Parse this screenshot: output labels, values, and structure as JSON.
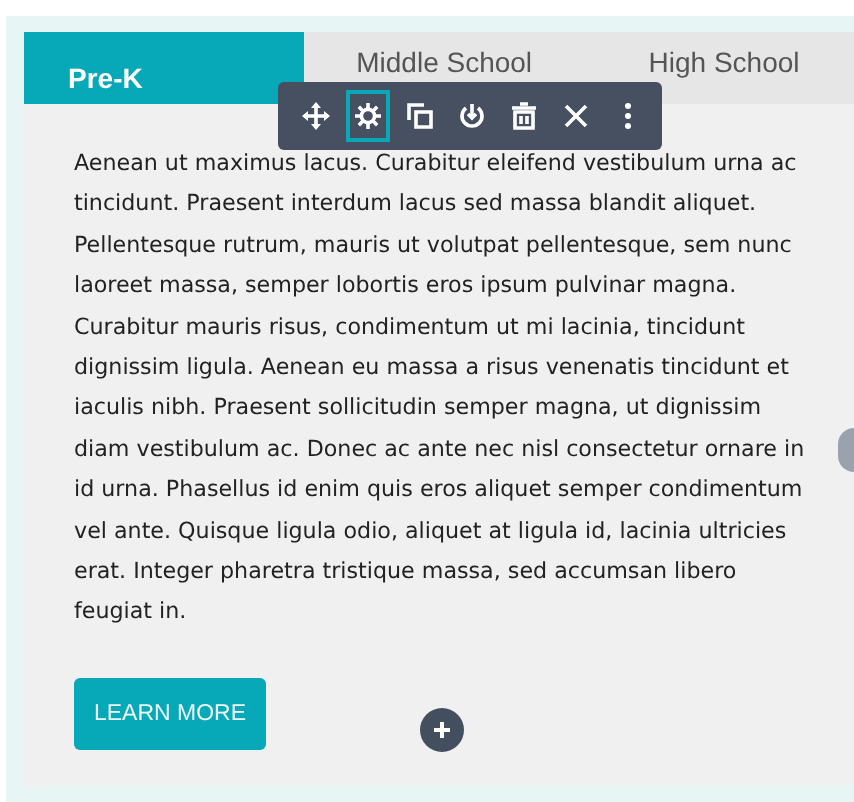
{
  "tabs": [
    {
      "label": "Pre-K",
      "selected": true
    },
    {
      "label": "Middle School",
      "selected": false
    },
    {
      "label": "High School",
      "selected": false
    }
  ],
  "toolbar": [
    {
      "kind": "move",
      "selected": false
    },
    {
      "kind": "settings",
      "selected": true
    },
    {
      "kind": "duplicate",
      "selected": false
    },
    {
      "kind": "power",
      "selected": false
    },
    {
      "kind": "delete",
      "selected": false
    },
    {
      "kind": "close",
      "selected": false
    },
    {
      "kind": "more",
      "selected": false
    }
  ],
  "body": "Aenean ut maximus lacus. Curabitur eleifend vestibulum urna ac tincidunt. Praesent interdum lacus sed massa blandit aliquet. Pellentesque rutrum, mauris ut volutpat pellentesque, sem nunc laoreet massa, semper lobortis eros ipsum pulvinar magna. Curabitur mauris risus, condimentum ut mi lacinia, tincidunt dignissim ligula. Aenean eu massa a risus venenatis tincidunt et iaculis nibh. Praesent sollicitudin semper magna, ut dignissim diam vestibulum ac. Donec ac ante nec nisl consectetur ornare in id urna. Phasellus id enim quis eros aliquet semper condimentum vel ante. Quisque ligula odio, aliquet at ligula id, lacinia ultricies erat. Integer pharetra tristique massa, sed accumsan libero feugiat in.",
  "button": "LEARN MORE"
}
